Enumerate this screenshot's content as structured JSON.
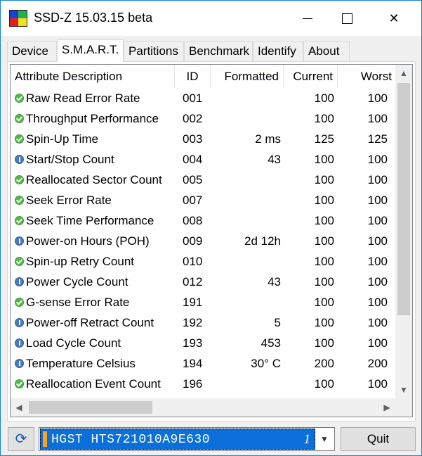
{
  "window": {
    "title": "SSD-Z 15.03.15 beta",
    "close_glyph": "✕"
  },
  "tabs": [
    {
      "label": "Device",
      "active": false
    },
    {
      "label": "S.M.A.R.T.",
      "active": true
    },
    {
      "label": "Partitions",
      "active": false
    },
    {
      "label": "Benchmark",
      "active": false
    },
    {
      "label": "Identify",
      "active": false
    },
    {
      "label": "About",
      "active": false
    }
  ],
  "smart": {
    "columns": [
      "Attribute Description",
      "ID",
      "Formatted",
      "Current",
      "Worst"
    ],
    "rows": [
      {
        "status": "ok",
        "desc": "Raw Read Error Rate",
        "id": "001",
        "formatted": "",
        "current": "100",
        "worst": "100"
      },
      {
        "status": "ok",
        "desc": "Throughput Performance",
        "id": "002",
        "formatted": "",
        "current": "100",
        "worst": "100"
      },
      {
        "status": "ok",
        "desc": "Spin-Up Time",
        "id": "003",
        "formatted": "2 ms",
        "current": "125",
        "worst": "125"
      },
      {
        "status": "info",
        "desc": "Start/Stop Count",
        "id": "004",
        "formatted": "43",
        "current": "100",
        "worst": "100"
      },
      {
        "status": "ok",
        "desc": "Reallocated Sector Count",
        "id": "005",
        "formatted": "",
        "current": "100",
        "worst": "100"
      },
      {
        "status": "ok",
        "desc": "Seek Error Rate",
        "id": "007",
        "formatted": "",
        "current": "100",
        "worst": "100"
      },
      {
        "status": "ok",
        "desc": "Seek Time Performance",
        "id": "008",
        "formatted": "",
        "current": "100",
        "worst": "100"
      },
      {
        "status": "info",
        "desc": "Power-on Hours (POH)",
        "id": "009",
        "formatted": "2d 12h",
        "current": "100",
        "worst": "100"
      },
      {
        "status": "ok",
        "desc": "Spin-up Retry Count",
        "id": "010",
        "formatted": "",
        "current": "100",
        "worst": "100"
      },
      {
        "status": "info",
        "desc": "Power Cycle Count",
        "id": "012",
        "formatted": "43",
        "current": "100",
        "worst": "100"
      },
      {
        "status": "ok",
        "desc": "G-sense Error Rate",
        "id": "191",
        "formatted": "",
        "current": "100",
        "worst": "100"
      },
      {
        "status": "info",
        "desc": "Power-off Retract Count",
        "id": "192",
        "formatted": "5",
        "current": "100",
        "worst": "100"
      },
      {
        "status": "info",
        "desc": "Load Cycle Count",
        "id": "193",
        "formatted": "453",
        "current": "100",
        "worst": "100"
      },
      {
        "status": "info",
        "desc": "Temperature Celsius",
        "id": "194",
        "formatted": "30° C",
        "current": "200",
        "worst": "200"
      },
      {
        "status": "ok",
        "desc": "Reallocation Event Count",
        "id": "196",
        "formatted": "",
        "current": "100",
        "worst": "100"
      }
    ]
  },
  "drive": {
    "name": "HGST HTS721010A9E630",
    "index": "1"
  },
  "buttons": {
    "quit": "Quit"
  },
  "icons": {
    "app": "ssd-z-app-icon",
    "refresh": "refresh-icon",
    "ok": "green-check-icon",
    "info": "blue-info-icon"
  },
  "colors": {
    "selection": "#0a6fd8",
    "accent_border": "#1883d7",
    "ok": "#52b848",
    "info": "#4a78c2"
  }
}
